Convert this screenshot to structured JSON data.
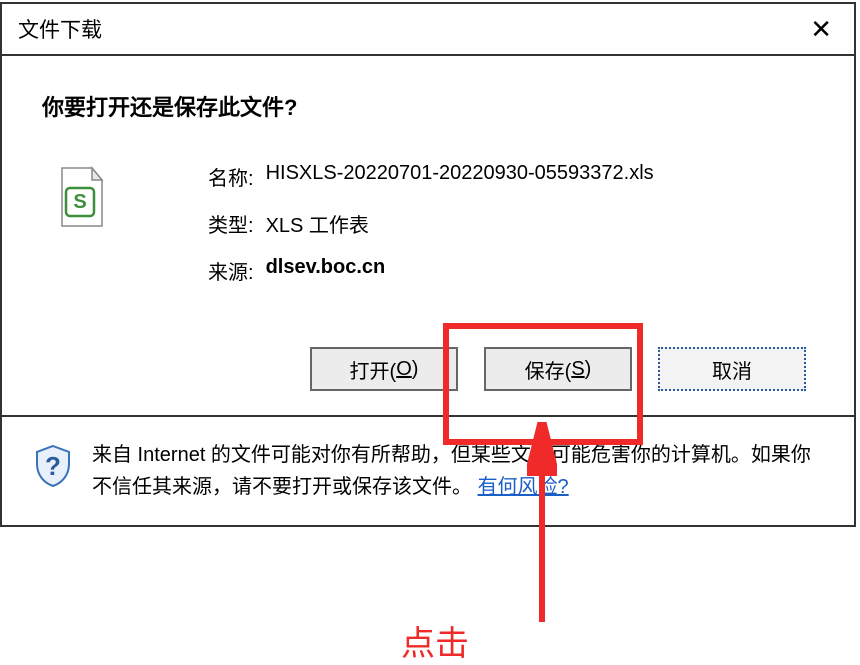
{
  "dialog": {
    "title": "文件下载",
    "question": "你要打开还是保存此文件?",
    "name_label": "名称:",
    "name_value": "HISXLS-20220701-20220930-05593372.xls",
    "type_label": "类型:",
    "type_value": "XLS 工作表",
    "source_label": "来源:",
    "source_value": "dlsev.boc.cn",
    "open_btn_pre": "打开(",
    "open_btn_key": "O",
    "open_btn_post": ")",
    "save_btn_pre": "保存(",
    "save_btn_key": "S",
    "save_btn_post": ")",
    "cancel_btn": "取消"
  },
  "footer": {
    "warning_pre": "来自 Internet 的文件可能对你有所帮助，但某些文件可能危害你的计算机。如果你不信任其来源，请不要打开或保存该文件。",
    "risk_link": "有何风险?"
  },
  "annotation": {
    "click_label": "点击"
  }
}
